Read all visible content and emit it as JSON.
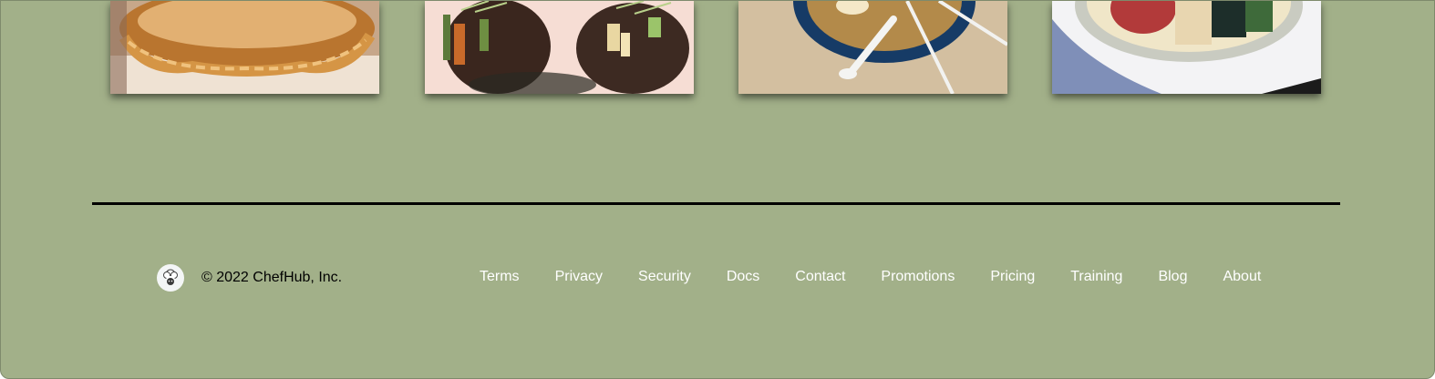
{
  "colors": {
    "page_background": "#a2b089",
    "divider": "#000000",
    "link_text": "#ffffff",
    "copyright_text": "#000000"
  },
  "gallery": {
    "photos": [
      {
        "subject": "pastry-tart"
      },
      {
        "subject": "sushi-rolls"
      },
      {
        "subject": "ramen-bowl"
      },
      {
        "subject": "poke-bowl"
      }
    ]
  },
  "footer": {
    "logo_icon": "chef-hat-logo-icon",
    "copyright": "© 2022 ChefHub, Inc.",
    "links": [
      "Terms",
      "Privacy",
      "Security",
      "Docs",
      "Contact",
      "Promotions",
      "Pricing",
      "Training",
      "Blog",
      "About"
    ]
  }
}
